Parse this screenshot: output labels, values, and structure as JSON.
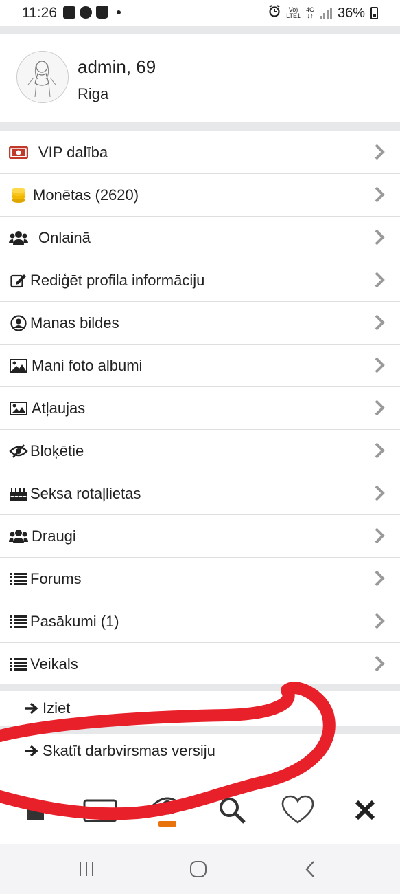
{
  "status": {
    "time": "11:26",
    "volte": "Vo)",
    "lte": "LTE1",
    "network": "4G",
    "battery": "36%"
  },
  "profile": {
    "name": "admin, 69",
    "city": "Riga"
  },
  "menu": {
    "items": [
      {
        "label": "VIP dalība",
        "icon": "money-icon"
      },
      {
        "label": "Monētas (2620)",
        "icon": "coins-icon"
      },
      {
        "label": "Onlainā",
        "icon": "users-icon"
      },
      {
        "label": "Rediģēt profila informāciju",
        "icon": "edit-icon"
      },
      {
        "label": "Manas bildes",
        "icon": "user-circle-icon"
      },
      {
        "label": "Mani foto albumi",
        "icon": "image-icon"
      },
      {
        "label": "Atļaujas",
        "icon": "image-icon"
      },
      {
        "label": "Bloķētie",
        "icon": "eye-slash-icon"
      },
      {
        "label": "Seksa rotaļlietas",
        "icon": "birthday-cake-icon"
      },
      {
        "label": "Draugi",
        "icon": "users-icon"
      },
      {
        "label": "Forums",
        "icon": "list-icon"
      },
      {
        "label": "Pasākumi (1)",
        "icon": "list-icon"
      },
      {
        "label": "Veikals",
        "icon": "list-icon"
      }
    ]
  },
  "footer_links": {
    "logout": "Iziet",
    "desktop": "Skatīt darbvirsmas versiju"
  },
  "bottom_nav": [
    "home-icon",
    "inbox-icon",
    "eye-icon",
    "search-icon",
    "heart-icon",
    "close-icon"
  ],
  "colors": {
    "section_gap": "#e7e8ea",
    "text": "#222222",
    "chevron": "#9a9a9a",
    "scribble": "#e8202a"
  }
}
